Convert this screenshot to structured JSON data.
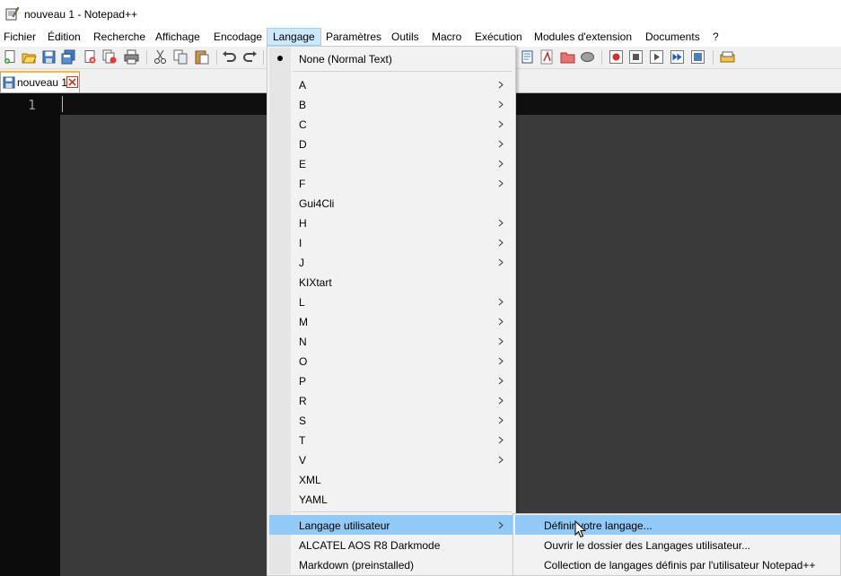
{
  "window": {
    "title": "nouveau 1 - Notepad++"
  },
  "menubar": {
    "fichier": "Fichier",
    "edition": "Édition",
    "recherche": "Recherche",
    "affichage": "Affichage",
    "encodage": "Encodage",
    "langage": "Langage",
    "parametres": "Paramètres",
    "outils": "Outils",
    "macro": "Macro",
    "execution": "Exécution",
    "modules": "Modules d'extension",
    "documents": "Documents",
    "help": "?"
  },
  "tab": {
    "label": "nouveau 1"
  },
  "editor": {
    "line_number": "1"
  },
  "langage_menu": {
    "none": "None (Normal Text)",
    "A": "A",
    "B": "B",
    "C": "C",
    "D": "D",
    "E": "E",
    "F": "F",
    "gui4cli": "Gui4Cli",
    "H": "H",
    "I": "I",
    "J": "J",
    "kixtart": "KIXtart",
    "L": "L",
    "M": "M",
    "N": "N",
    "O": "O",
    "P": "P",
    "R": "R",
    "S": "S",
    "T": "T",
    "V": "V",
    "xml": "XML",
    "yaml": "YAML",
    "user_lang": "Langage utilisateur",
    "alcatel": "ALCATEL AOS R8 Darkmode",
    "markdown": "Markdown (preinstalled)"
  },
  "user_lang_submenu": {
    "define": "Définir votre langage...",
    "open_folder": "Ouvrir le dossier des Langages utilisateur...",
    "collection": "Collection de langages définis par l'utilisateur Notepad++"
  },
  "colors": {
    "menu_highlight": "#91c9f7",
    "active_menu": "#cce8ff",
    "editor_bg": "#3a3a3a",
    "gutter_bg": "#0c0c0c"
  }
}
